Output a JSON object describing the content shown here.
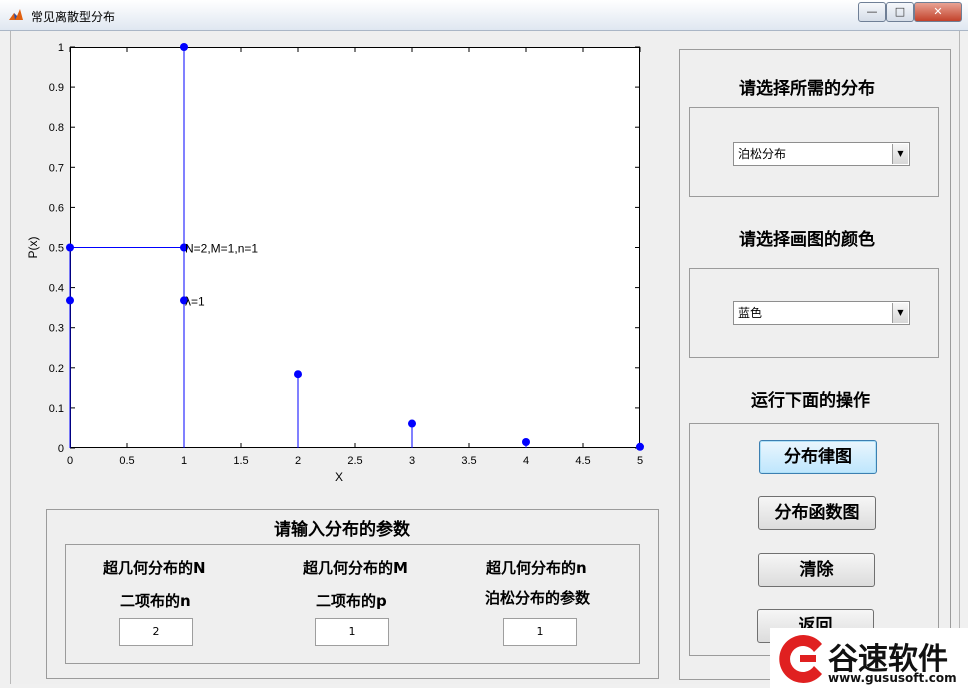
{
  "window": {
    "title": "常见离散型分布"
  },
  "chart_data": {
    "type": "stem",
    "xlabel": "X",
    "ylabel": "P(x)",
    "xlim": [
      0,
      5
    ],
    "ylim": [
      0,
      1
    ],
    "xticks": [
      "0",
      "0.5",
      "1",
      "1.5",
      "2",
      "2.5",
      "3",
      "3.5",
      "4",
      "4.5",
      "5"
    ],
    "yticks": [
      "0",
      "0.1",
      "0.2",
      "0.3",
      "0.4",
      "0.5",
      "0.6",
      "0.7",
      "0.8",
      "0.9",
      "1"
    ],
    "series": [
      {
        "x": [
          0,
          1,
          2,
          3,
          4,
          5
        ],
        "y": [
          0.368,
          0.368,
          0.184,
          0.061,
          0.015,
          0.003
        ]
      },
      {
        "x": [
          0,
          1
        ],
        "y": [
          0.5,
          0.5
        ]
      },
      {
        "x": [
          1
        ],
        "y": [
          1
        ]
      }
    ],
    "annotations": [
      {
        "text": "N=2,M=1,n=1",
        "x": 1,
        "y": 0.5
      },
      {
        "text": "λ=1",
        "x": 1,
        "y": 0.368
      }
    ],
    "color": "#0000ff"
  },
  "right_panel": {
    "dist_title": "请选择所需的分布",
    "dist_selected": "泊松分布",
    "color_title": "请选择画图的颜色",
    "color_selected": "蓝色",
    "ops_title": "运行下面的操作",
    "btn_pmf": "分布律图",
    "btn_cdf": "分布函数图",
    "btn_clear": "清除",
    "btn_back": "返回"
  },
  "params": {
    "title": "请输入分布的参数",
    "col1_line1": "超几何分布的N",
    "col1_line2": "二项布的n",
    "col1_value": "2",
    "col2_line1": "超几何分布的M",
    "col2_line2": "二项布的p",
    "col2_value": "1",
    "col3_line1": "超几何分布的n",
    "col3_line2": "泊松分布的参数",
    "col3_value": "1"
  },
  "watermark": {
    "brand": "谷速软件",
    "url": "www.gususoft.com"
  }
}
